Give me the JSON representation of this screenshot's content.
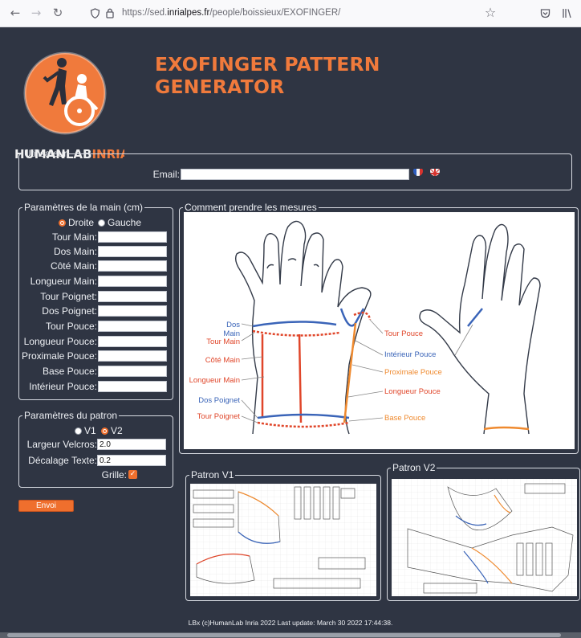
{
  "browser": {
    "url_prefix": "https://sed.",
    "url_domain": "inrialpes.fr",
    "url_path": "/people/boissieux/EXOFINGER/"
  },
  "header": {
    "title": "EXOFINGER PATTERN GENERATOR",
    "logo_text_1": "HUMANLAB",
    "logo_text_2": "INRIA"
  },
  "user": {
    "legend": "Utilisateur",
    "email_label": "Email:",
    "email_value": ""
  },
  "hand": {
    "legend": "Paramètres de la main (cm)",
    "side_right": "Droite",
    "side_left": "Gauche",
    "selected_side": "Droite",
    "fields": [
      {
        "label": "Tour Main:",
        "value": ""
      },
      {
        "label": "Dos Main:",
        "value": ""
      },
      {
        "label": "Côté Main:",
        "value": ""
      },
      {
        "label": "Longueur Main:",
        "value": ""
      },
      {
        "label": "Tour Poignet:",
        "value": ""
      },
      {
        "label": "Dos Poignet:",
        "value": ""
      },
      {
        "label": "Tour Pouce:",
        "value": ""
      },
      {
        "label": "Longueur Pouce:",
        "value": ""
      },
      {
        "label": "Proximale Pouce:",
        "value": ""
      },
      {
        "label": "Base Pouce:",
        "value": ""
      },
      {
        "label": "Intérieur Pouce:",
        "value": ""
      }
    ]
  },
  "pattern": {
    "legend": "Paramètres du patron",
    "v1": "V1",
    "v2": "V2",
    "selected_version": "V2",
    "velcro_label": "Largeur Velcros:",
    "velcro_value": "2.0",
    "offset_label": "Décalage Texte:",
    "offset_value": "0.2",
    "grid_label": "Grille:",
    "grid_checked": true
  },
  "send_label": "Envoi",
  "measures": {
    "legend": "Comment prendre les mesures",
    "left_labels": [
      {
        "text": "Dos Main",
        "color": "#3a64b8"
      },
      {
        "text": "Tour Main",
        "color": "#e0462a"
      },
      {
        "text": "Côté Main",
        "color": "#e0462a"
      },
      {
        "text": "Longueur Main",
        "color": "#e0462a"
      },
      {
        "text": "Dos Poignet",
        "color": "#3a64b8"
      },
      {
        "text": "Tour Poignet",
        "color": "#e0462a"
      }
    ],
    "right_labels": [
      {
        "text": "Tour Pouce",
        "color": "#e0462a"
      },
      {
        "text": "Intérieur Pouce",
        "color": "#3a64b8"
      },
      {
        "text": "Proximale Pouce",
        "color": "#ef8a2f"
      },
      {
        "text": "Longueur Pouce",
        "color": "#e0462a"
      },
      {
        "text": "Base Pouce",
        "color": "#ef8a2f"
      }
    ]
  },
  "patron_v1": {
    "legend": "Patron V1"
  },
  "patron_v2": {
    "legend": "Patron V2"
  },
  "footer": "LBx (c)HumanLab Inria 2022 Last update: March 30 2022 17:44:38.",
  "colors": {
    "accent": "#ef6f2d",
    "background": "#2f3543",
    "blue": "#3a64b8",
    "red": "#e0462a"
  }
}
